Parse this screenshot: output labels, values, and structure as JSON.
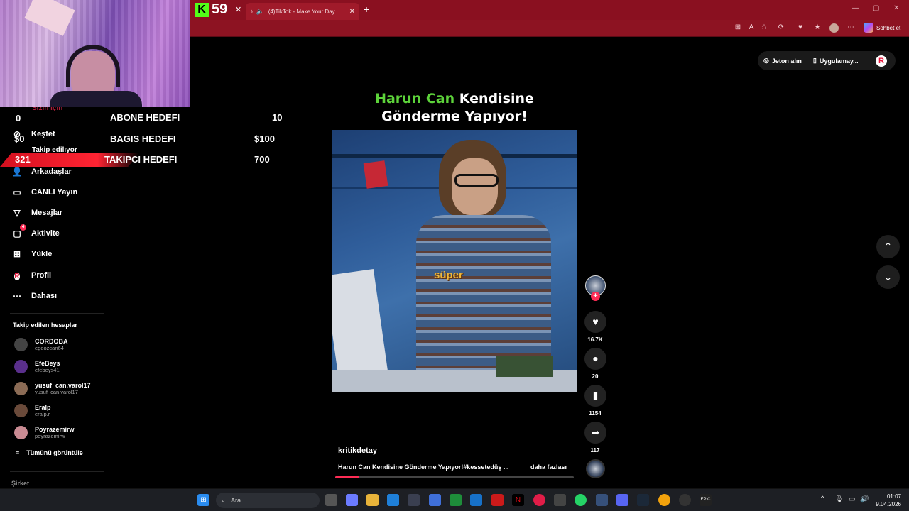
{
  "browser": {
    "kick_number": "59",
    "tab_title": "(4)TikTok - Make Your Day",
    "copilot_label": "Sohbet et"
  },
  "overlay": {
    "goals": [
      {
        "number": "0",
        "label": "ABONE HEDEFI",
        "value": "10"
      },
      {
        "number": "$0",
        "label": "BAGIS HEDEFI",
        "value": "$100"
      },
      {
        "number": "321",
        "label": "TAKIPCI HEDEFI",
        "value": "700"
      }
    ]
  },
  "sidebar": {
    "items": [
      {
        "label": "Sizin için",
        "icon": "home-icon"
      },
      {
        "label": "Keşfet",
        "icon": "compass-icon"
      },
      {
        "label": "Takip edilıyor",
        "icon": "following-icon"
      },
      {
        "label": "Arkadaşlar",
        "icon": "friends-icon"
      },
      {
        "label": "CANLI Yayın",
        "icon": "live-icon"
      },
      {
        "label": "Mesajlar",
        "icon": "message-icon"
      },
      {
        "label": "Aktivite",
        "icon": "activity-icon",
        "badge": "4"
      },
      {
        "label": "Yükle",
        "icon": "upload-icon"
      },
      {
        "label": "Profil",
        "icon": "profile-icon"
      },
      {
        "label": "Dahası",
        "icon": "more-icon"
      }
    ],
    "following_heading": "Takip edilen hesaplar",
    "accounts": [
      {
        "name": "CORDOBA",
        "username": "egeozcan64",
        "color": "#444"
      },
      {
        "name": "EfeBeys",
        "username": "efebeys41",
        "color": "#5a2f8c"
      },
      {
        "name": "yusuf_can.varol17",
        "username": "yusuf_can.varol17",
        "color": "#8b6b55"
      },
      {
        "name": "Eralp",
        "username": "eralp.r",
        "color": "#6a4a3a"
      },
      {
        "name": "Poyrazemirw",
        "username": "poyrazemirw",
        "color": "#c98b93"
      }
    ],
    "see_all": "Tümünü görüntüle",
    "company": "Şirket"
  },
  "topbar": {
    "coins": "Jeton alın",
    "app": "Uygulamay..."
  },
  "video": {
    "title_green": "Harun Can",
    "title_rest_line1": " Kendisine",
    "title_line2": "Gönderme Yapıyor!",
    "subtitle": "süper",
    "author": "kritikdetay",
    "description": "Harun Can Kendisine Gönderme Yapıyor!#kessetedüş ...",
    "more": "daha fazlası",
    "progress": 0.1
  },
  "actions": {
    "likes": "16.7K",
    "comments": "20",
    "saves": "1154",
    "shares": "117"
  },
  "taskbar": {
    "search_label": "Ara",
    "time": "01:07",
    "date": "9.04.2026"
  },
  "colors": {
    "brand_red": "#fe2c55",
    "title_green": "#5dd33a",
    "browser_red": "#8a1020"
  }
}
